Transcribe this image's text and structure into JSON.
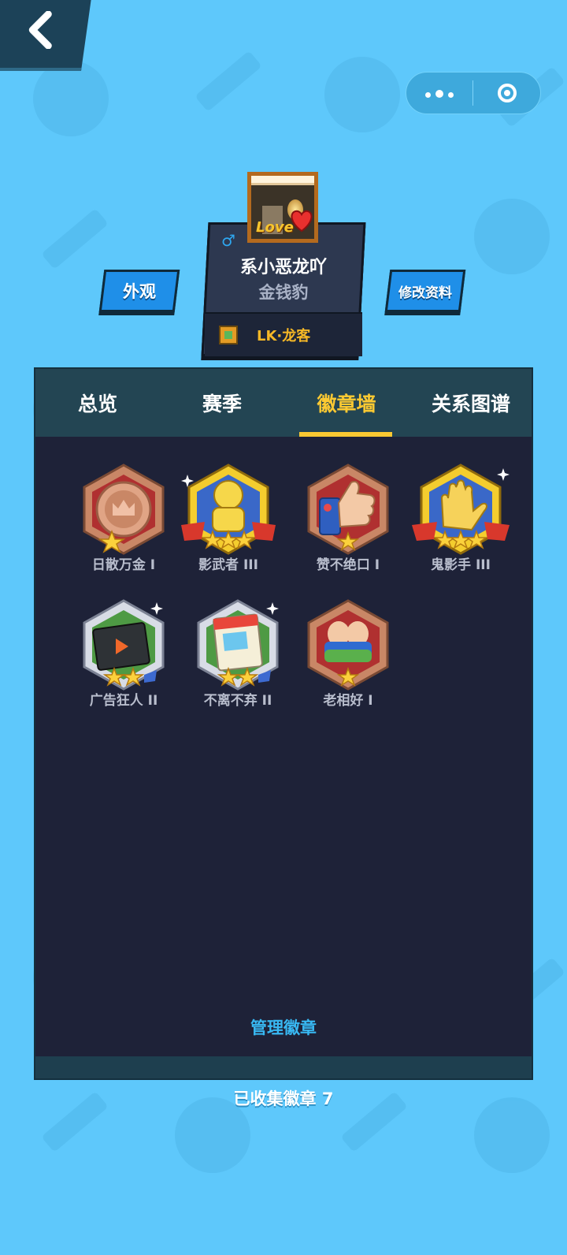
{
  "header": {
    "back_icon": "chevron-left-icon",
    "capsule": {
      "more_icon": "more-dots-icon",
      "close_icon": "target-close-icon"
    }
  },
  "profile": {
    "gender_symbol": "♂",
    "nickname": "系小恶龙吖",
    "rank": "金钱豹",
    "guild": "LK·龙客",
    "avatar_text": "Love"
  },
  "buttons": {
    "appearance": "外观",
    "edit_profile": "修改资料"
  },
  "tabs": [
    {
      "label": "总览",
      "active": false
    },
    {
      "label": "赛季",
      "active": false
    },
    {
      "label": "徽章墙",
      "active": true
    },
    {
      "label": "关系图谱",
      "active": false
    }
  ],
  "badges": [
    {
      "label": "日散万金 I",
      "tier": "bronze",
      "icon": "crown-coin-icon",
      "stars": 1
    },
    {
      "label": "影武者 III",
      "tier": "gold",
      "icon": "ninja-icon",
      "stars": 3
    },
    {
      "label": "赞不绝口 I",
      "tier": "bronze",
      "icon": "thumbs-up-icon",
      "stars": 1
    },
    {
      "label": "鬼影手 III",
      "tier": "gold",
      "icon": "glove-hand-icon",
      "stars": 3
    },
    {
      "label": "广告狂人 II",
      "tier": "silver",
      "icon": "video-play-icon",
      "stars": 2
    },
    {
      "label": "不离不弃 II",
      "tier": "silver",
      "icon": "calendar-icon",
      "stars": 2
    },
    {
      "label": "老相好 I",
      "tier": "bronze",
      "icon": "hug-icon",
      "stars": 1
    }
  ],
  "manage_link": "管理徽章",
  "collected_text": "已收集徽章 7",
  "colors": {
    "background": "#5ec8fb",
    "panel": "#1e2238",
    "accent": "#fbc932",
    "link": "#38b8f2"
  }
}
